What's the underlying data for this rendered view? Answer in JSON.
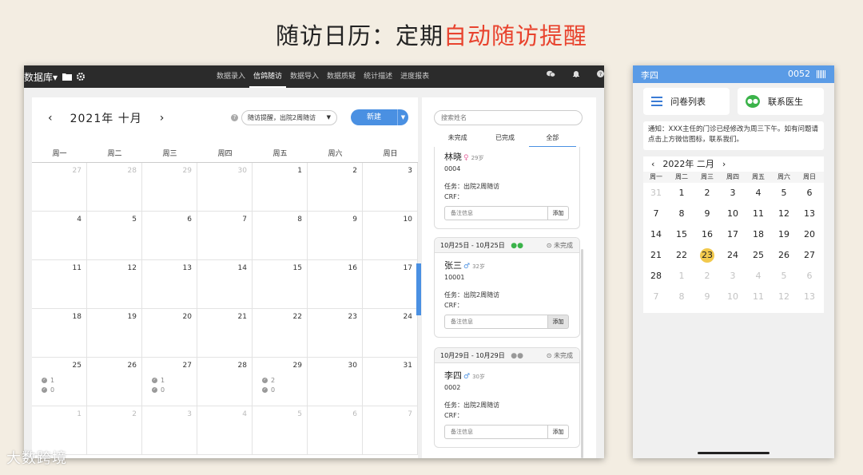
{
  "slide": {
    "title_main": "随访日历：定期",
    "title_accent": "自动随访提醒",
    "accent_color": "#e8432e"
  },
  "desktop": {
    "brand": "数据库▾",
    "brand_icons": [
      "folder-icon",
      "gear-icon"
    ],
    "nav": [
      "数据录入",
      "信鸽随访",
      "数据导入",
      "数据质疑",
      "统计描述",
      "进度报表"
    ],
    "nav_active": "信鸽随访",
    "calendar": {
      "prev": "‹",
      "next": "›",
      "month_title": "2021年 十月",
      "help": "?",
      "reminder_select": "随访提醒，出院2周随访",
      "new_button": "新建",
      "weekdays": [
        "周一",
        "周二",
        "周三",
        "周四",
        "周五",
        "周六",
        "周日"
      ],
      "days": [
        "27",
        "28",
        "29",
        "30",
        "1",
        "2",
        "3",
        "4",
        "5",
        "6",
        "7",
        "8",
        "9",
        "10",
        "11",
        "12",
        "13",
        "14",
        "15",
        "16",
        "17",
        "18",
        "19",
        "20",
        "21",
        "22",
        "23",
        "24",
        "25",
        "26",
        "27",
        "28",
        "29",
        "30",
        "31",
        "1",
        "2",
        "3",
        "4",
        "5",
        "6",
        "7"
      ],
      "stats": {
        "25": [
          "1",
          "0"
        ],
        "27": [
          "1",
          "0"
        ],
        "29": [
          "2",
          "0"
        ]
      }
    },
    "side": {
      "search_placeholder": "搜索姓名",
      "tabs": [
        "未完成",
        "已完成",
        "全部"
      ],
      "active_tab": "全部",
      "cards": [
        {
          "date": "",
          "name": "林晓",
          "gender": "♀",
          "age": "29岁",
          "id": "0004",
          "task": "任务：出院2周随访",
          "crf": "CRF：",
          "note_placeholder": "备注信息",
          "add": "添加",
          "status": ""
        },
        {
          "date": "10月25日 - 10月25日",
          "name": "张三",
          "gender": "♂",
          "age": "32岁",
          "id": "10001",
          "task": "任务：出院2周随访",
          "crf": "CRF：",
          "note_placeholder": "备注信息",
          "add": "添加",
          "status": "未完成"
        },
        {
          "date": "10月29日 - 10月29日",
          "name": "李四",
          "gender": "♂",
          "age": "30岁",
          "id": "0002",
          "task": "任务：出院2周随访",
          "crf": "CRF：",
          "note_placeholder": "备注信息",
          "add": "添加",
          "status": "未完成"
        }
      ]
    }
  },
  "phone": {
    "user": "李四",
    "code": "0052",
    "btn_questionnaire": "问卷列表",
    "btn_contact": "联系医生",
    "notice": "通知：XXX主任的门诊已经修改为周三下午。如有问题请点击上方微信图标，联系我们。",
    "cal_prev": "‹",
    "cal_next": "›",
    "cal_title": "2022年 二月",
    "weekdays": [
      "周一",
      "周二",
      "周三",
      "周四",
      "周五",
      "周六",
      "周日"
    ],
    "days": [
      "31",
      "1",
      "2",
      "3",
      "4",
      "5",
      "6",
      "7",
      "8",
      "9",
      "10",
      "11",
      "12",
      "13",
      "14",
      "15",
      "16",
      "17",
      "18",
      "19",
      "20",
      "21",
      "22",
      "23",
      "24",
      "25",
      "26",
      "27",
      "28",
      "1",
      "2",
      "3",
      "4",
      "5",
      "6",
      "7",
      "8",
      "9",
      "10",
      "11",
      "12",
      "13"
    ],
    "today": "23",
    "today_color": "#f2c94c"
  },
  "watermark": "大数跨境"
}
